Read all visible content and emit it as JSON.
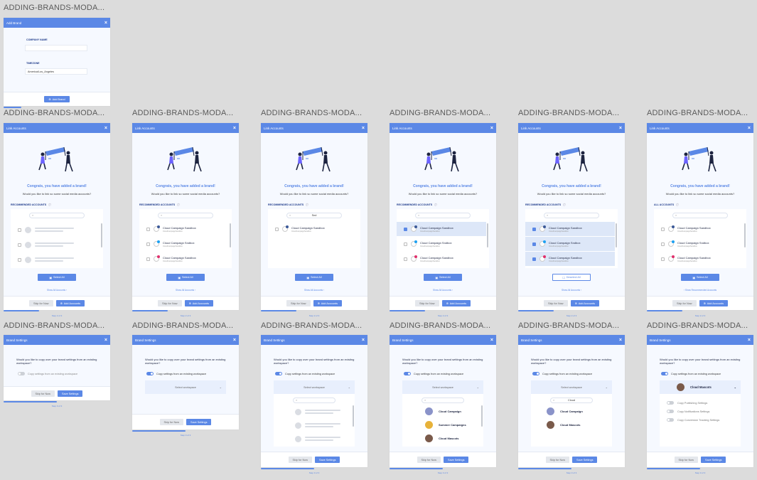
{
  "frame_label": "ADDING-BRANDS-MODA...",
  "add_brand": {
    "title": "Add Brand",
    "company_label": "COMPANY NAME",
    "company_value": "",
    "timezone_label": "TIMEZONE",
    "timezone_value": "America/Los_Angeles",
    "submit": "Add Brand"
  },
  "link": {
    "title": "Link Accounts",
    "congrats": "Congrats, you have added a brand!",
    "question": "Would you like to link so some social media accounts?",
    "recommended": "RECOMMENDED ACCOUNTS",
    "all": "ALL ACCOUNTS",
    "select_all": "Select All",
    "deselect_all": "Deselect All",
    "show_all": "Show All Accounts",
    "show_recommended": "Show Recommended Accounts",
    "skip": "Skip for Now",
    "add": "Add Accounts",
    "step": "Step 2 of 3",
    "search_query": "Snd",
    "accounts": [
      {
        "name": "Cloud Campaign Sandbox",
        "sub": "CloudCampaignSandbox",
        "network": "facebook",
        "color": "#3b5998"
      },
      {
        "name": "Cloud Campaign Sndbox",
        "sub": "CloudCampaignSandbox",
        "network": "twitter",
        "color": "#1da1f2"
      },
      {
        "name": "Cloud Campaign Sandbox",
        "sub": "CloudCampaignSandbox",
        "network": "instagram",
        "color": "#e1306c"
      }
    ]
  },
  "brand": {
    "title": "Brand Settings",
    "question": "Would you like to copy over your brand settings from an existing workspace?",
    "copy": "Copy settings from an existing workspace",
    "select": "Select workspace",
    "skip": "Skip for Now",
    "save": "Save Settings",
    "step": "Step 3 of 3",
    "search_query": "Cloud",
    "workspaces": [
      {
        "name": "Cloud Campaign",
        "color": "#8a93c9"
      },
      {
        "name": "Summer Campaigns",
        "color": "#e7b23a"
      },
      {
        "name": "Cloud Mascots",
        "color": "#7a5a4a"
      }
    ],
    "selected_workspace": "Cloud Mascots",
    "options": [
      "Copy Publishing Settings",
      "Copy Notifications Settings",
      "Copy Conversion Tracking Settings"
    ]
  },
  "colors": {
    "accent": "#5b88e6",
    "header": "#5b88e6",
    "panel": "#f6f9ff"
  }
}
